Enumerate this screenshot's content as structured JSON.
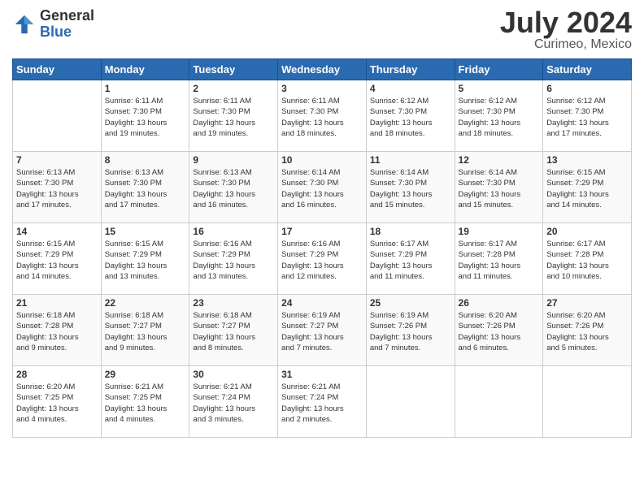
{
  "header": {
    "logo_general": "General",
    "logo_blue": "Blue",
    "title": "July 2024",
    "location": "Curimeo, Mexico"
  },
  "days_of_week": [
    "Sunday",
    "Monday",
    "Tuesday",
    "Wednesday",
    "Thursday",
    "Friday",
    "Saturday"
  ],
  "weeks": [
    [
      {
        "day": "",
        "info": ""
      },
      {
        "day": "1",
        "info": "Sunrise: 6:11 AM\nSunset: 7:30 PM\nDaylight: 13 hours\nand 19 minutes."
      },
      {
        "day": "2",
        "info": "Sunrise: 6:11 AM\nSunset: 7:30 PM\nDaylight: 13 hours\nand 19 minutes."
      },
      {
        "day": "3",
        "info": "Sunrise: 6:11 AM\nSunset: 7:30 PM\nDaylight: 13 hours\nand 18 minutes."
      },
      {
        "day": "4",
        "info": "Sunrise: 6:12 AM\nSunset: 7:30 PM\nDaylight: 13 hours\nand 18 minutes."
      },
      {
        "day": "5",
        "info": "Sunrise: 6:12 AM\nSunset: 7:30 PM\nDaylight: 13 hours\nand 18 minutes."
      },
      {
        "day": "6",
        "info": "Sunrise: 6:12 AM\nSunset: 7:30 PM\nDaylight: 13 hours\nand 17 minutes."
      }
    ],
    [
      {
        "day": "7",
        "info": "Sunrise: 6:13 AM\nSunset: 7:30 PM\nDaylight: 13 hours\nand 17 minutes."
      },
      {
        "day": "8",
        "info": "Sunrise: 6:13 AM\nSunset: 7:30 PM\nDaylight: 13 hours\nand 17 minutes."
      },
      {
        "day": "9",
        "info": "Sunrise: 6:13 AM\nSunset: 7:30 PM\nDaylight: 13 hours\nand 16 minutes."
      },
      {
        "day": "10",
        "info": "Sunrise: 6:14 AM\nSunset: 7:30 PM\nDaylight: 13 hours\nand 16 minutes."
      },
      {
        "day": "11",
        "info": "Sunrise: 6:14 AM\nSunset: 7:30 PM\nDaylight: 13 hours\nand 15 minutes."
      },
      {
        "day": "12",
        "info": "Sunrise: 6:14 AM\nSunset: 7:30 PM\nDaylight: 13 hours\nand 15 minutes."
      },
      {
        "day": "13",
        "info": "Sunrise: 6:15 AM\nSunset: 7:29 PM\nDaylight: 13 hours\nand 14 minutes."
      }
    ],
    [
      {
        "day": "14",
        "info": "Sunrise: 6:15 AM\nSunset: 7:29 PM\nDaylight: 13 hours\nand 14 minutes."
      },
      {
        "day": "15",
        "info": "Sunrise: 6:15 AM\nSunset: 7:29 PM\nDaylight: 13 hours\nand 13 minutes."
      },
      {
        "day": "16",
        "info": "Sunrise: 6:16 AM\nSunset: 7:29 PM\nDaylight: 13 hours\nand 13 minutes."
      },
      {
        "day": "17",
        "info": "Sunrise: 6:16 AM\nSunset: 7:29 PM\nDaylight: 13 hours\nand 12 minutes."
      },
      {
        "day": "18",
        "info": "Sunrise: 6:17 AM\nSunset: 7:29 PM\nDaylight: 13 hours\nand 11 minutes."
      },
      {
        "day": "19",
        "info": "Sunrise: 6:17 AM\nSunset: 7:28 PM\nDaylight: 13 hours\nand 11 minutes."
      },
      {
        "day": "20",
        "info": "Sunrise: 6:17 AM\nSunset: 7:28 PM\nDaylight: 13 hours\nand 10 minutes."
      }
    ],
    [
      {
        "day": "21",
        "info": "Sunrise: 6:18 AM\nSunset: 7:28 PM\nDaylight: 13 hours\nand 9 minutes."
      },
      {
        "day": "22",
        "info": "Sunrise: 6:18 AM\nSunset: 7:27 PM\nDaylight: 13 hours\nand 9 minutes."
      },
      {
        "day": "23",
        "info": "Sunrise: 6:18 AM\nSunset: 7:27 PM\nDaylight: 13 hours\nand 8 minutes."
      },
      {
        "day": "24",
        "info": "Sunrise: 6:19 AM\nSunset: 7:27 PM\nDaylight: 13 hours\nand 7 minutes."
      },
      {
        "day": "25",
        "info": "Sunrise: 6:19 AM\nSunset: 7:26 PM\nDaylight: 13 hours\nand 7 minutes."
      },
      {
        "day": "26",
        "info": "Sunrise: 6:20 AM\nSunset: 7:26 PM\nDaylight: 13 hours\nand 6 minutes."
      },
      {
        "day": "27",
        "info": "Sunrise: 6:20 AM\nSunset: 7:26 PM\nDaylight: 13 hours\nand 5 minutes."
      }
    ],
    [
      {
        "day": "28",
        "info": "Sunrise: 6:20 AM\nSunset: 7:25 PM\nDaylight: 13 hours\nand 4 minutes."
      },
      {
        "day": "29",
        "info": "Sunrise: 6:21 AM\nSunset: 7:25 PM\nDaylight: 13 hours\nand 4 minutes."
      },
      {
        "day": "30",
        "info": "Sunrise: 6:21 AM\nSunset: 7:24 PM\nDaylight: 13 hours\nand 3 minutes."
      },
      {
        "day": "31",
        "info": "Sunrise: 6:21 AM\nSunset: 7:24 PM\nDaylight: 13 hours\nand 2 minutes."
      },
      {
        "day": "",
        "info": ""
      },
      {
        "day": "",
        "info": ""
      },
      {
        "day": "",
        "info": ""
      }
    ]
  ]
}
